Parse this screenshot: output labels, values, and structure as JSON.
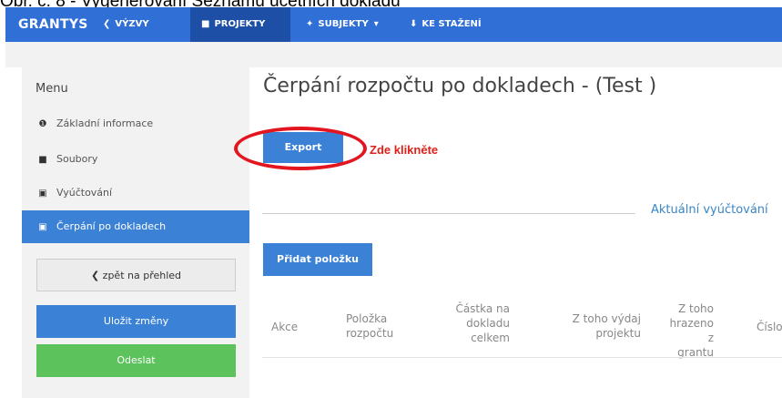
{
  "caption": {
    "prefix": "Obr. č. 8 - Vygenerování ",
    "link": "Seznamu účetních dokladů"
  },
  "navbar": {
    "brand": "GRANTYS",
    "items": [
      {
        "label": "VÝZVY",
        "icon": "megaphone-icon"
      },
      {
        "label": "PROJEKTY",
        "icon": "document-icon"
      },
      {
        "label": "SUBJEKTY",
        "icon": "users-icon"
      },
      {
        "label": "KE STAŽENÍ",
        "icon": "download-icon"
      }
    ]
  },
  "sidebar": {
    "title": "Menu",
    "items": [
      {
        "label": "Základní informace",
        "icon": "info-icon"
      },
      {
        "label": "Soubory",
        "icon": "folder-icon"
      },
      {
        "label": "Vyúčtování",
        "icon": "money-icon"
      },
      {
        "label": "Čerpání po dokladech",
        "icon": "money-icon"
      }
    ],
    "back_label": "❮ zpět na přehled",
    "save_label": "Uložit změny",
    "send_label": "Odeslat"
  },
  "main": {
    "title": "Čerpání rozpočtu po dokladech - (Test  )",
    "export_label": "Export",
    "annotation": "Zde klikněte",
    "current_link": "Aktuální vyúčtování",
    "add_label": "Přidat položku",
    "columns": [
      [
        "Akce"
      ],
      [
        "Položka",
        "rozpočtu"
      ],
      [
        "Částka na",
        "dokladu",
        "celkem"
      ],
      [
        "Z toho výdaj",
        "projektu"
      ],
      [
        "Z toho",
        "hrazeno z",
        "grantu"
      ],
      [
        "Číslo"
      ]
    ]
  },
  "colors": {
    "nav": "#2f6fd6",
    "active": "#3b82d6",
    "send": "#5cc25c",
    "annotation": "#e0201a"
  }
}
